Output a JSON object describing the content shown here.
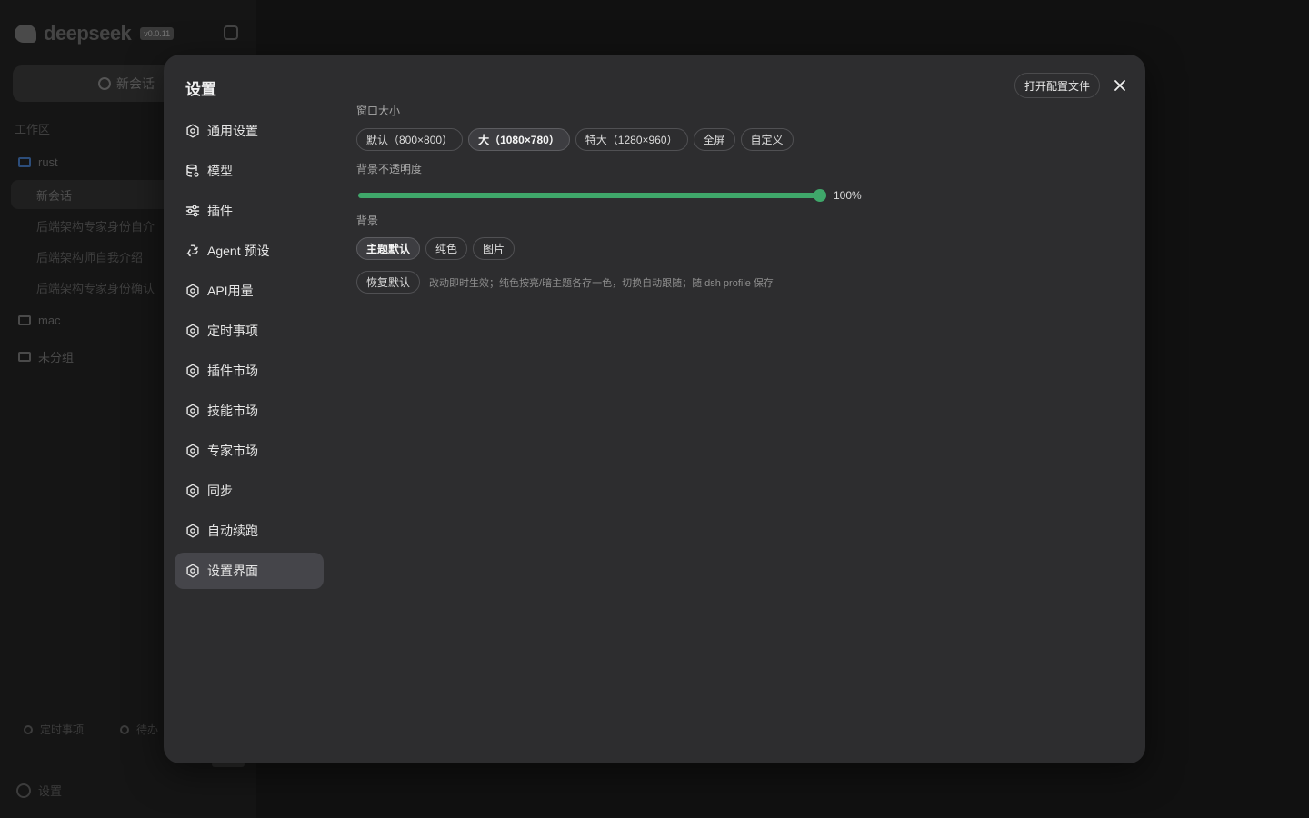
{
  "background_app": {
    "brand": "deepseek",
    "version": "v0.0.11",
    "new_chat": "新会话",
    "section": "工作区",
    "folders": [
      {
        "label": "rust"
      },
      {
        "label": "mac"
      },
      {
        "label": "未分组"
      }
    ],
    "chats": [
      {
        "label": "新会话"
      },
      {
        "label": "后端架构专家身份自介"
      },
      {
        "label": "后端架构师自我介绍"
      },
      {
        "label": "后端架构专家身份确认"
      }
    ],
    "bottom": [
      "定时事项",
      "待办"
    ],
    "settings": "设置"
  },
  "modal": {
    "title": "设置",
    "open_config": "打开配置文件",
    "nav": [
      {
        "label": "通用设置",
        "icon": "gear-icon"
      },
      {
        "label": "模型",
        "icon": "database-icon"
      },
      {
        "label": "插件",
        "icon": "sliders-icon"
      },
      {
        "label": "Agent 预设",
        "icon": "recycle-icon"
      },
      {
        "label": "API用量",
        "icon": "gear-icon"
      },
      {
        "label": "定时事项",
        "icon": "gear-icon"
      },
      {
        "label": "插件市场",
        "icon": "gear-icon"
      },
      {
        "label": "技能市场",
        "icon": "gear-icon"
      },
      {
        "label": "专家市场",
        "icon": "gear-icon"
      },
      {
        "label": "同步",
        "icon": "gear-icon"
      },
      {
        "label": "自动续跑",
        "icon": "gear-icon"
      },
      {
        "label": "设置界面",
        "icon": "gear-icon",
        "active": true
      }
    ],
    "window_size": {
      "label": "窗口大小",
      "options": [
        "默认（800×800）",
        "大（1080×780）",
        "特大（1280×960）",
        "全屏",
        "自定义"
      ],
      "selected": "大（1080×780）"
    },
    "opacity": {
      "label": "背景不透明度",
      "value": 100,
      "display": "100%",
      "color": "#3fa76a"
    },
    "background": {
      "label": "背景",
      "options": [
        "主题默认",
        "纯色",
        "图片"
      ],
      "selected": "主题默认"
    },
    "reset": {
      "label": "恢复默认",
      "hint": "改动即时生效；纯色按亮/暗主题各存一色，切换自动跟随；随 dsh profile 保存"
    }
  }
}
